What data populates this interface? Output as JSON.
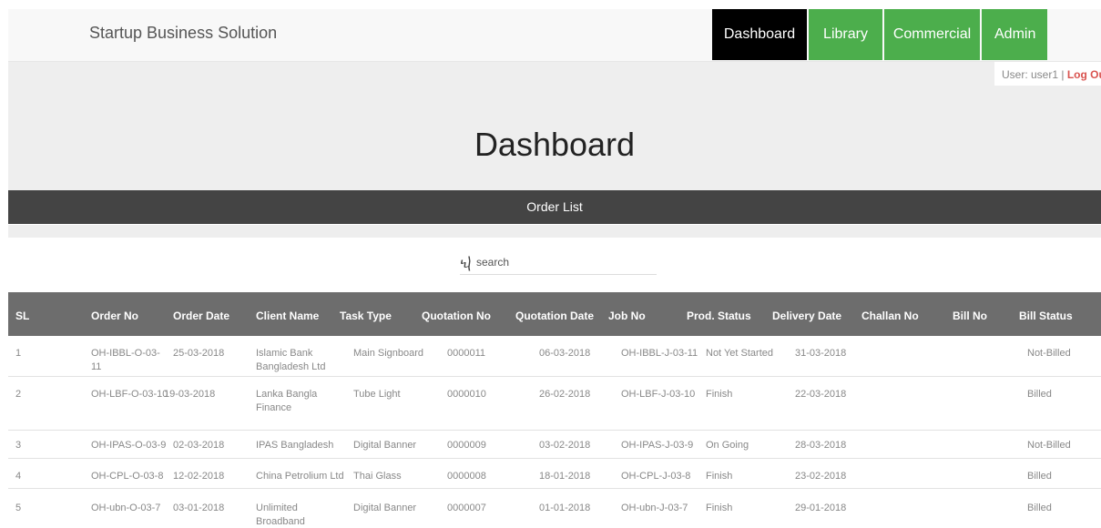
{
  "app": {
    "brand": "Startup Business Solution"
  },
  "nav": {
    "dashboard": "Dashboard",
    "library": "Library",
    "commercial": "Commercial",
    "admin": "Admin"
  },
  "user": {
    "label": "User: user1",
    "separator": "|",
    "logout": "Log Out"
  },
  "page": {
    "title": "Dashboard",
    "section": "Order List"
  },
  "search": {
    "placeholder": "search",
    "icon": "search-icon"
  },
  "table": {
    "headers": {
      "sl": "SL",
      "order_no": "Order No",
      "order_date": "Order Date",
      "client_name": "Client Name",
      "task_type": "Task Type",
      "quotation_no": "Quotation No",
      "quotation_date": "Quotation Date",
      "job_no": "Job No",
      "prod_status": "Prod. Status",
      "delivery_date": "Delivery Date",
      "challan_no": "Challan No",
      "bill_no": "Bill No",
      "bill_status": "Bill Status"
    },
    "rows": [
      {
        "sl": "1",
        "order_no": "OH-IBBL-O-03-11",
        "order_date": "25-03-2018",
        "client_name": "Islamic Bank Bangladesh Ltd",
        "task_type": "Main Signboard",
        "quotation_no": "0000011",
        "quotation_date": "06-03-2018",
        "job_no": "OH-IBBL-J-03-11",
        "prod_status": "Not Yet Started",
        "delivery_date": "31-03-2018",
        "challan_no": "",
        "bill_no": "",
        "bill_status": "Not-Billed"
      },
      {
        "sl": "2",
        "order_no": "OH-LBF-O-03-10",
        "order_date": "19-03-2018",
        "client_name": "Lanka Bangla Finance",
        "task_type": "Tube Light",
        "quotation_no": "0000010",
        "quotation_date": "26-02-2018",
        "job_no": "OH-LBF-J-03-10",
        "prod_status": "Finish",
        "delivery_date": "22-03-2018",
        "challan_no": "",
        "bill_no": "",
        "bill_status": "Billed"
      },
      {
        "sl": "3",
        "order_no": "OH-IPAS-O-03-9",
        "order_date": "02-03-2018",
        "client_name": "IPAS Bangladesh",
        "task_type": "Digital Banner",
        "quotation_no": "0000009",
        "quotation_date": "03-02-2018",
        "job_no": "OH-IPAS-J-03-9",
        "prod_status": "On Going",
        "delivery_date": "28-03-2018",
        "challan_no": "",
        "bill_no": "",
        "bill_status": "Not-Billed"
      },
      {
        "sl": "4",
        "order_no": "OH-CPL-O-03-8",
        "order_date": "12-02-2018",
        "client_name": "China Petrolium Ltd",
        "task_type": "Thai Glass",
        "quotation_no": "0000008",
        "quotation_date": "18-01-2018",
        "job_no": "OH-CPL-J-03-8",
        "prod_status": "Finish",
        "delivery_date": "23-02-2018",
        "challan_no": "",
        "bill_no": "",
        "bill_status": "Billed"
      },
      {
        "sl": "5",
        "order_no": "OH-ubn-O-03-7",
        "order_date": "03-01-2018",
        "client_name": "Unlimited Broadband Network",
        "task_type": "Digital Banner",
        "quotation_no": "0000007",
        "quotation_date": "01-01-2018",
        "job_no": "OH-ubn-J-03-7",
        "prod_status": "Finish",
        "delivery_date": "29-01-2018",
        "challan_no": "",
        "bill_no": "",
        "bill_status": "Billed"
      }
    ]
  },
  "colors": {
    "nav_active": "#000000",
    "nav_green": "#4cae4c",
    "logout": "#d9534f",
    "section_bar": "#444444",
    "table_header": "#6d6d6d"
  }
}
